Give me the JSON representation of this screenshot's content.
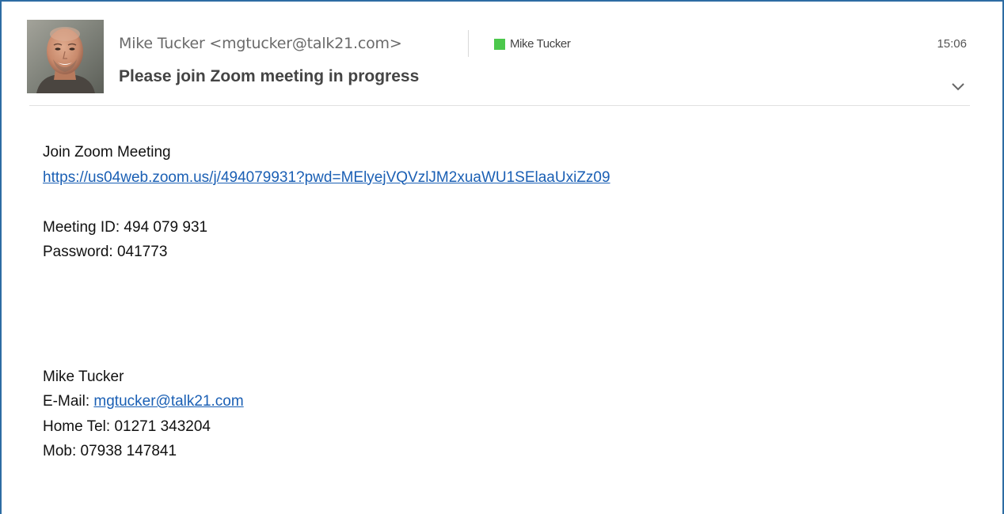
{
  "email": {
    "sender": "Mike Tucker <mgtucker@talk21.com>",
    "category": {
      "label": "Mike Tucker",
      "color": "#4cc84c"
    },
    "time": "15:06",
    "subject": "Please join Zoom meeting in progress",
    "expand_icon": "chevron-down-icon",
    "avatar_icon": "sender-photo"
  },
  "body": {
    "join_label": "Join Zoom Meeting",
    "join_link": "https://us04web.zoom.us/j/494079931?pwd=MElyejVQVzlJM2xuaWU1SElaaUxiZz09",
    "meeting_id": "Meeting ID: 494 079 931",
    "password": "Password: 041773"
  },
  "signature": {
    "name": "Mike Tucker",
    "email_label": "E-Mail: ",
    "email": "mgtucker@talk21.com",
    "home_tel": "Home Tel: 01271 343204",
    "mobile": "Mob: 07938 147841"
  },
  "colors": {
    "frame_border": "#2d6ca3",
    "link": "#1a5fb4"
  }
}
